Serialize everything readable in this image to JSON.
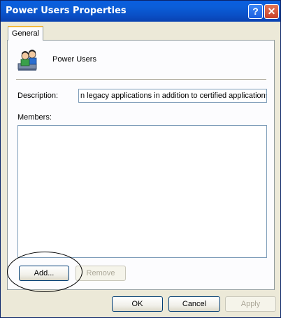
{
  "window": {
    "title": "Power Users Properties"
  },
  "titlebar": {
    "help_glyph": "?",
    "close_glyph": "✕"
  },
  "tabs": [
    {
      "label": "General"
    }
  ],
  "group": {
    "name": "Power Users",
    "icon": "users-group-icon"
  },
  "description": {
    "label": "Description:",
    "value": "n legacy applications in addition to certified applications"
  },
  "members": {
    "label": "Members:",
    "items": []
  },
  "buttons": {
    "add": "Add...",
    "remove": "Remove",
    "ok": "OK",
    "cancel": "Cancel",
    "apply": "Apply"
  },
  "colors": {
    "titlebar": "#0a5fe0",
    "dialog": "#ece9d8",
    "focus_tab": "#f4b93e",
    "field_border": "#7f9db9"
  }
}
